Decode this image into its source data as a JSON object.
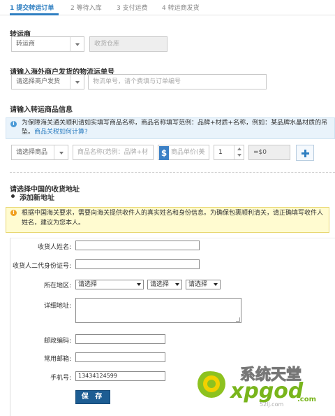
{
  "steps": [
    {
      "label": "1 提交转运订单"
    },
    {
      "label": "2 等待入库"
    },
    {
      "label": "3 支付运费"
    },
    {
      "label": "4 转运商发货"
    }
  ],
  "carrier": {
    "title": "转运商",
    "select_value": "转运商",
    "warehouse_placeholder": "收货仓库"
  },
  "tracking": {
    "title": "请输入海外商户发货的物流运单号",
    "merchant_select": "请选择商户发货",
    "tracking_placeholder": "物流单号，请个费填与订单编号"
  },
  "goods": {
    "title": "请输入转运商品信息",
    "info_text": "为保障海关通关顺利请如实填写商品名称，商品名称填写范例：品牌+材质+名称，例如：某品牌水晶材质的吊坠。",
    "info_link": "商品关税如何计算?",
    "item_select": "请选择商品",
    "name_placeholder": "商品名称(范例：品牌+材",
    "price_symbol": "$",
    "price_placeholder": "商品单价(美",
    "quantity": "1",
    "subtotal": "=$0"
  },
  "address": {
    "title": "请选择中国的收货地址",
    "add_new": "添加新地址",
    "warning": "根据中国海关要求，需要向海关提供收件人的真实姓名和身份信息。为确保包裹顺利清关，请正确填写收件人姓名，建议为您本人。",
    "form": {
      "name_label": "收货人姓名:",
      "id_label": "收货人二代身份证号:",
      "region_label": "所在地区:",
      "region_selects": [
        "请选择",
        "请选择",
        "请选择"
      ],
      "detail_label": "详细地址:",
      "postcode_label": "邮政编码:",
      "email_label": "常用邮箱:",
      "phone_label": "手机号:",
      "phone_value": "13434124599",
      "save_label": "保 存"
    }
  },
  "watermark": {
    "brand": "系统天堂",
    "site": "xpgod",
    "tld": ".com",
    "sub": "52lj.com"
  },
  "colors": {
    "accent": "#2f7fc1",
    "save": "#1d5d93",
    "info_bg": "#e9f3fb",
    "warn_bg": "#fffbd0"
  }
}
